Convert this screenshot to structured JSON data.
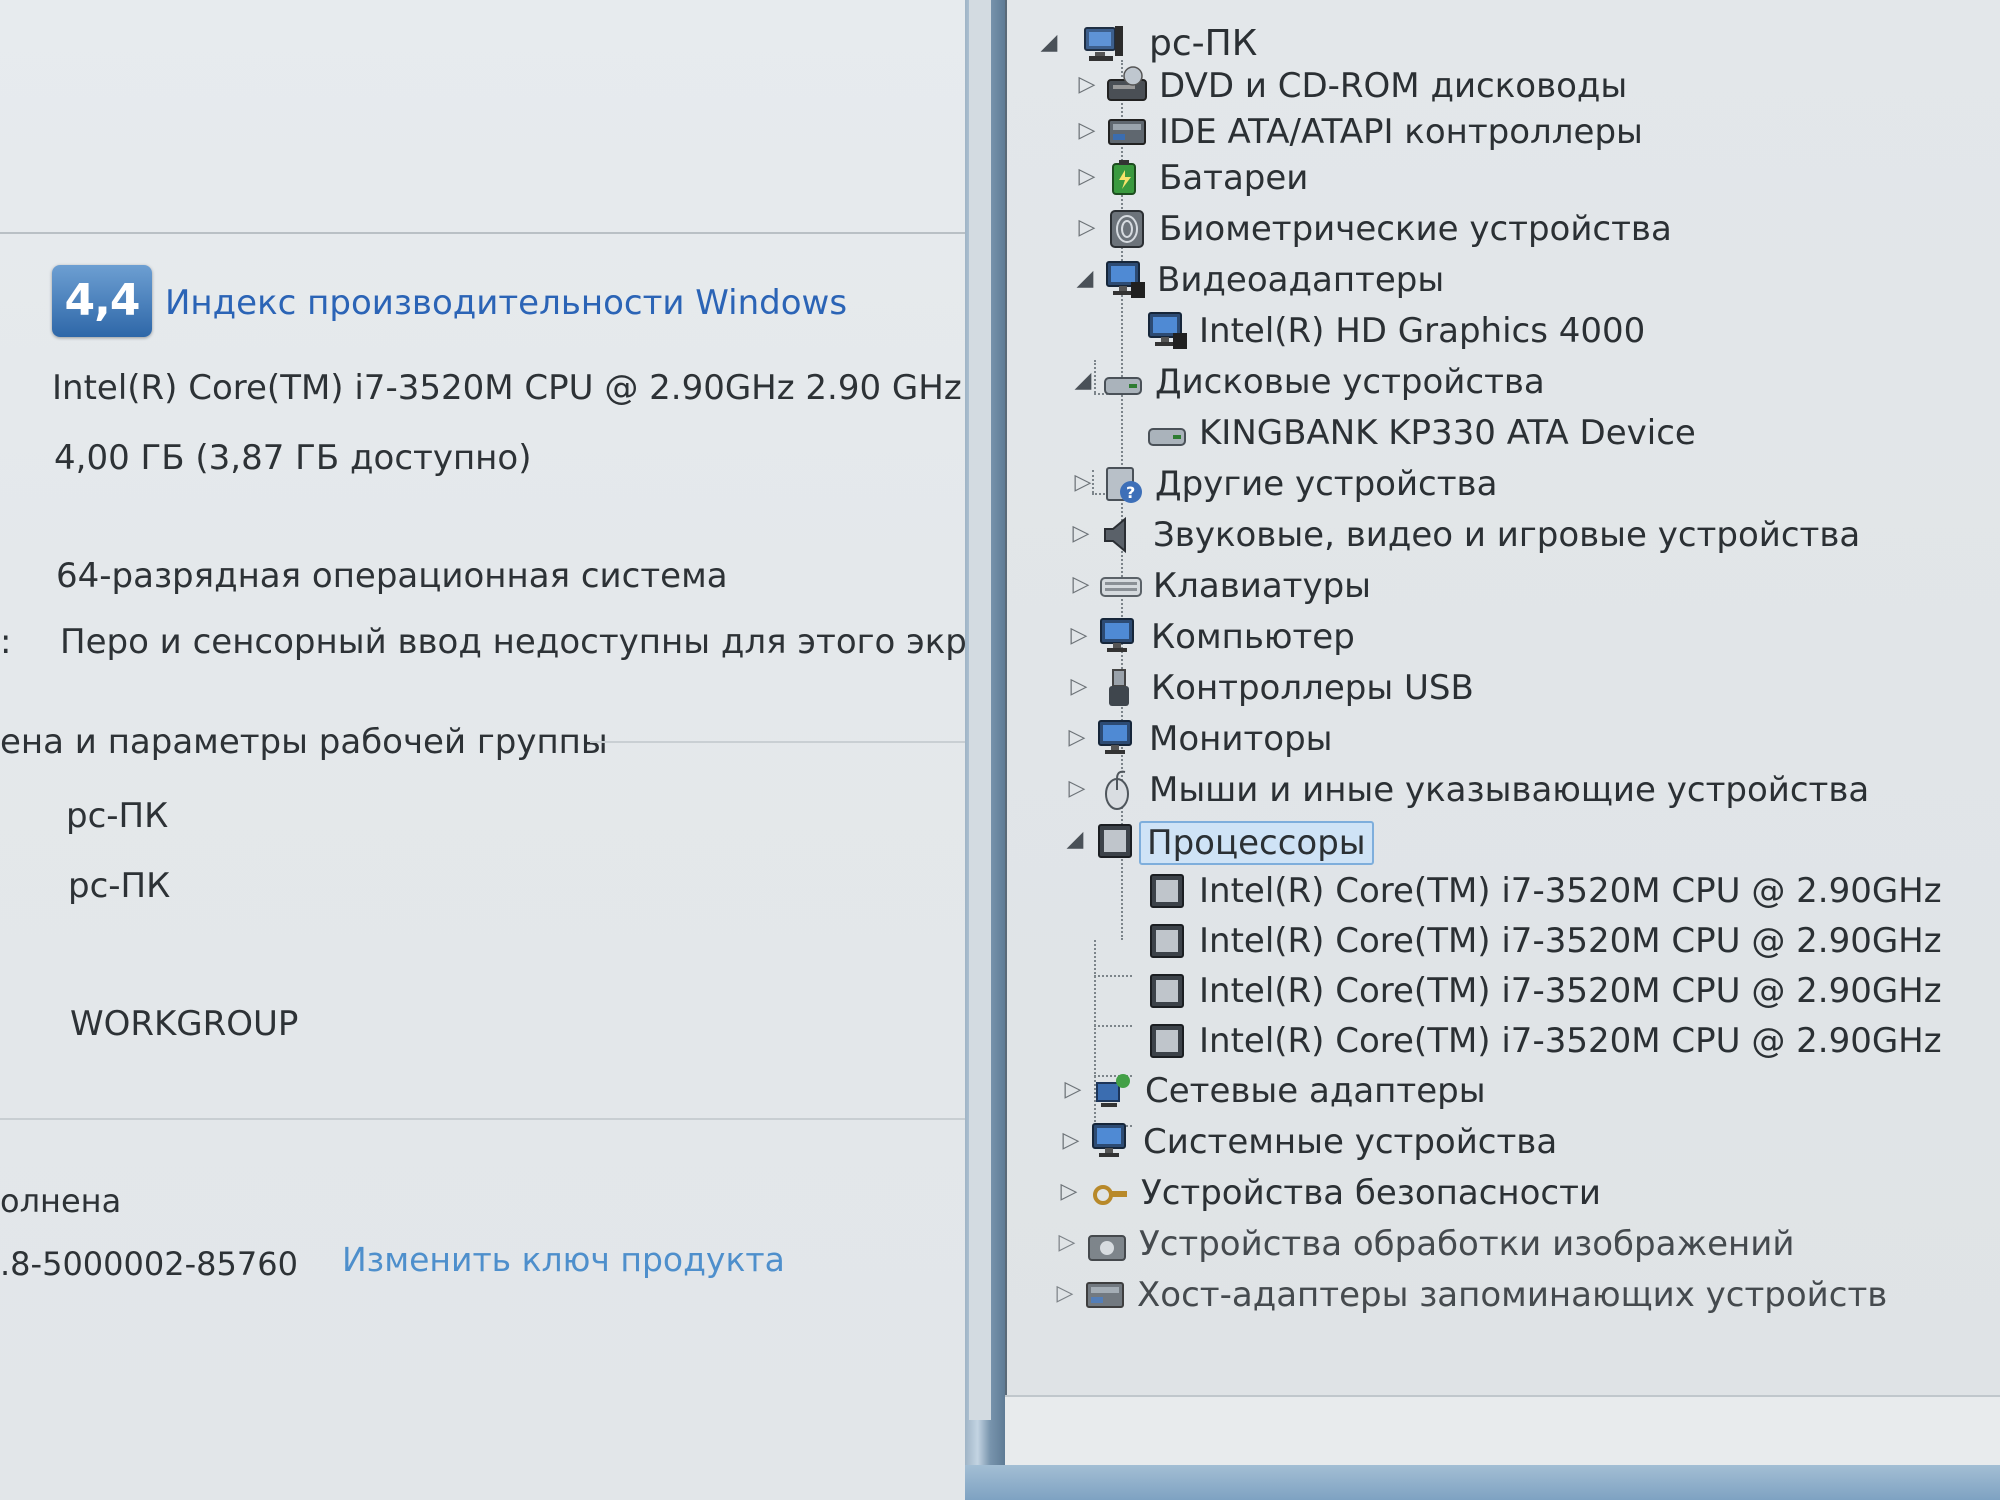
{
  "system": {
    "wei_score": "4,4",
    "wei_link": "Индекс производительности Windows",
    "processor": "Intel(R) Core(TM) i7-3520M CPU @ 2.90GHz   2.90 GHz",
    "memory": "4,00 ГБ (3,87 ГБ доступно)",
    "os_type": "64-разрядная операционная система",
    "pen_prefix": ":",
    "pen_touch": "Перо и сенсорный ввод недоступны для этого экрана",
    "section_title": "ена и параметры рабочей группы",
    "computer_name": "pc-ПК",
    "full_name": "pc-ПК",
    "workgroup": "WORKGROUP",
    "activation": "олнена",
    "product_id": ".8-5000002-85760",
    "change_key_link": "Изменить ключ продукта"
  },
  "device_manager": {
    "root": "pc-ПК",
    "categories": [
      {
        "label": "DVD и CD-ROM дисководы",
        "icon": "dvd-drive-icon",
        "expanded": false
      },
      {
        "label": "IDE ATA/ATAPI контроллеры",
        "icon": "ide-controller-icon",
        "expanded": false
      },
      {
        "label": "Батареи",
        "icon": "battery-icon",
        "expanded": false
      },
      {
        "label": "Биометрические устройства",
        "icon": "fingerprint-icon",
        "expanded": false
      },
      {
        "label": "Видеоадаптеры",
        "icon": "display-adapter-icon",
        "expanded": true
      },
      {
        "label": "Intel(R) HD Graphics 4000",
        "icon": "display-adapter-icon",
        "child": true
      },
      {
        "label": "Дисковые устройства",
        "icon": "disk-drive-icon",
        "expanded": true
      },
      {
        "label": "KINGBANK KP330 ATA Device",
        "icon": "disk-drive-icon",
        "child": true
      },
      {
        "label": "Другие устройства",
        "icon": "unknown-device-icon",
        "expanded": false
      },
      {
        "label": "Звуковые, видео и игровые устройства",
        "icon": "speaker-icon",
        "expanded": false
      },
      {
        "label": "Клавиатуры",
        "icon": "keyboard-icon",
        "expanded": false
      },
      {
        "label": "Компьютер",
        "icon": "computer-icon",
        "expanded": false
      },
      {
        "label": "Контроллеры USB",
        "icon": "usb-icon",
        "expanded": false
      },
      {
        "label": "Мониторы",
        "icon": "monitor-icon",
        "expanded": false
      },
      {
        "label": "Мыши и иные указывающие устройства",
        "icon": "mouse-icon",
        "expanded": false
      },
      {
        "label": "Процессоры",
        "icon": "processor-icon",
        "expanded": true,
        "selected": true
      },
      {
        "label": "Intel(R) Core(TM) i7-3520M CPU @ 2.90GHz",
        "icon": "processor-icon",
        "child": true
      },
      {
        "label": "Intel(R) Core(TM) i7-3520M CPU @ 2.90GHz",
        "icon": "processor-icon",
        "child": true
      },
      {
        "label": "Intel(R) Core(TM) i7-3520M CPU @ 2.90GHz",
        "icon": "processor-icon",
        "child": true
      },
      {
        "label": "Intel(R) Core(TM) i7-3520M CPU @ 2.90GHz",
        "icon": "processor-icon",
        "child": true
      },
      {
        "label": "Сетевые адаптеры",
        "icon": "network-adapter-icon",
        "expanded": false
      },
      {
        "label": "Системные устройства",
        "icon": "system-devices-icon",
        "expanded": false
      },
      {
        "label": "Устройства безопасности",
        "icon": "security-devices-icon",
        "expanded": false
      },
      {
        "label": "Устройства обработки изображений",
        "icon": "imaging-device-icon",
        "expanded": false
      },
      {
        "label": "Хост-адаптеры запоминающих устройств",
        "icon": "storage-controller-icon",
        "expanded": false
      }
    ]
  },
  "colors": {
    "link": "#2b64b6",
    "selection": "#cfe3f6",
    "wei_badge": "#2e67a8"
  }
}
